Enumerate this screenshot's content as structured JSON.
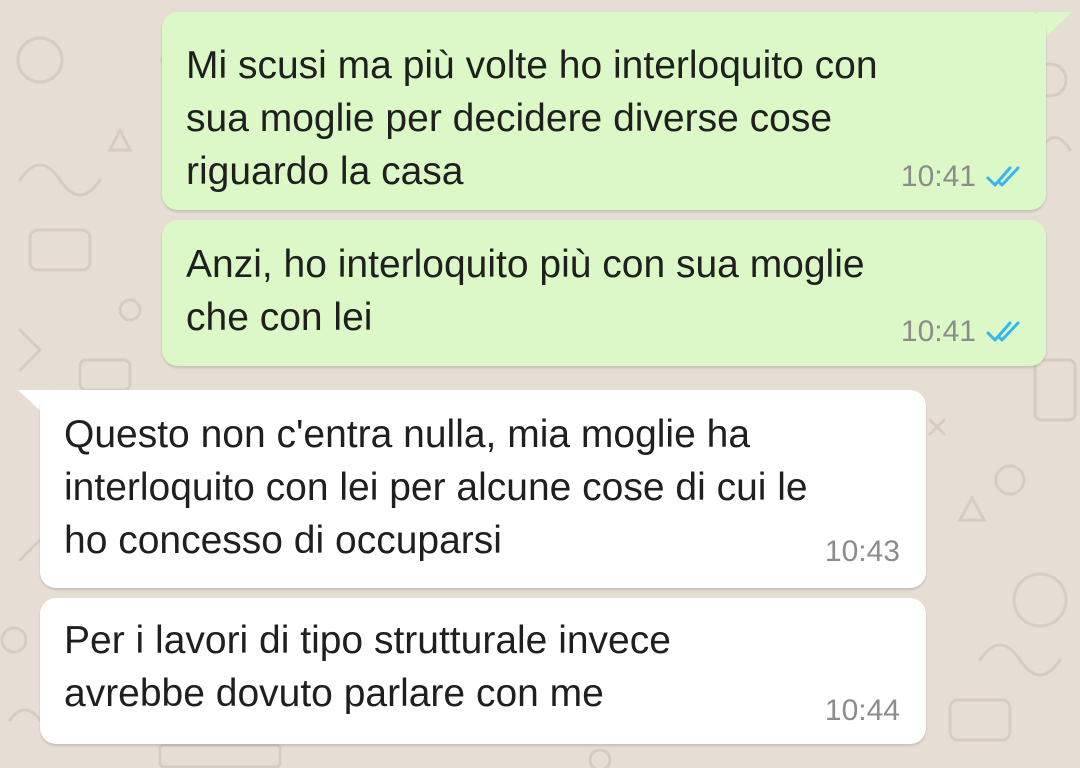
{
  "conversation": {
    "messages": [
      {
        "direction": "outgoing",
        "text": "Mi scusi ma più volte ho interloquito con\nsua moglie per decidere diverse cose\nriguardo la casa",
        "time": "10:41",
        "status": "read"
      },
      {
        "direction": "outgoing",
        "text": "Anzi, ho interloquito più con sua moglie\nche con lei",
        "time": "10:41",
        "status": "read"
      },
      {
        "direction": "incoming",
        "text": "Questo non c'entra nulla, mia moglie ha\ninterloquito con lei per alcune cose di cui le\nho concesso di occuparsi",
        "time": "10:43"
      },
      {
        "direction": "incoming",
        "text": "Per i lavori di tipo strutturale invece\navrebbe dovuto parlare con me",
        "time": "10:44"
      }
    ]
  },
  "icons": {
    "read_receipt": "double-check-icon"
  },
  "colors": {
    "wallpaper": "#e6ddd4",
    "outgoing_bubble": "#dcf8c6",
    "incoming_bubble": "#ffffff",
    "read_tick": "#34b7f1",
    "timestamp": "#8c8c8c"
  }
}
